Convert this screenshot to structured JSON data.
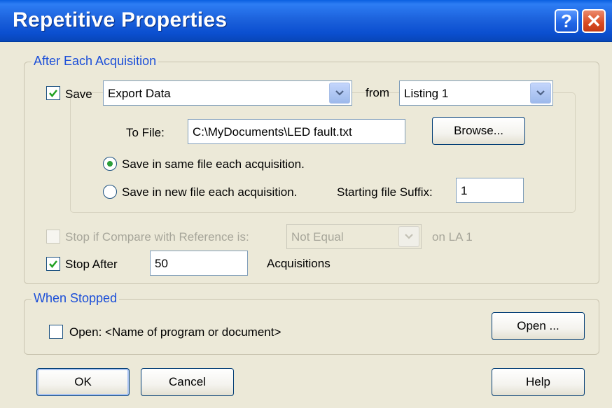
{
  "window": {
    "title": "Repetitive Properties",
    "help_label": "?",
    "close_label": "✕"
  },
  "after_each": {
    "legend": "After Each Acquisition",
    "save_checkbox": {
      "checked": true,
      "label": "Save"
    },
    "save_type": {
      "value": "Export Data"
    },
    "from_label": "from",
    "from_source": {
      "value": "Listing 1"
    },
    "to_file": {
      "label": "To File:",
      "value": "C:\\MyDocuments\\LED fault.txt"
    },
    "browse_label": "Browse...",
    "radio_same": {
      "label": "Save in same file each acquisition.",
      "selected": true
    },
    "radio_new": {
      "label": "Save in new file each acquisition.",
      "selected": false
    },
    "suffix": {
      "label": "Starting file Suffix:",
      "value": "1"
    },
    "stop_compare": {
      "checked": false,
      "enabled": false,
      "label": "Stop if Compare with Reference is:"
    },
    "compare_value": {
      "value": "Not Equal",
      "enabled": false
    },
    "compare_target": "on LA 1",
    "stop_after": {
      "checked": true,
      "label": "Stop After",
      "value": "50",
      "units": "Acquisitions"
    }
  },
  "when_stopped": {
    "legend": "When Stopped",
    "open_checkbox": {
      "checked": false,
      "label": "Open: <Name of program or document>"
    },
    "open_button": "Open ..."
  },
  "buttons": {
    "ok": "OK",
    "cancel": "Cancel",
    "help": "Help"
  },
  "colors": {
    "title_bar": "#0b4fd0",
    "dialog_bg": "#ece9d8",
    "group_legend": "#1c4fd8",
    "check_mark": "#21a121",
    "close_button": "#d94a22"
  }
}
